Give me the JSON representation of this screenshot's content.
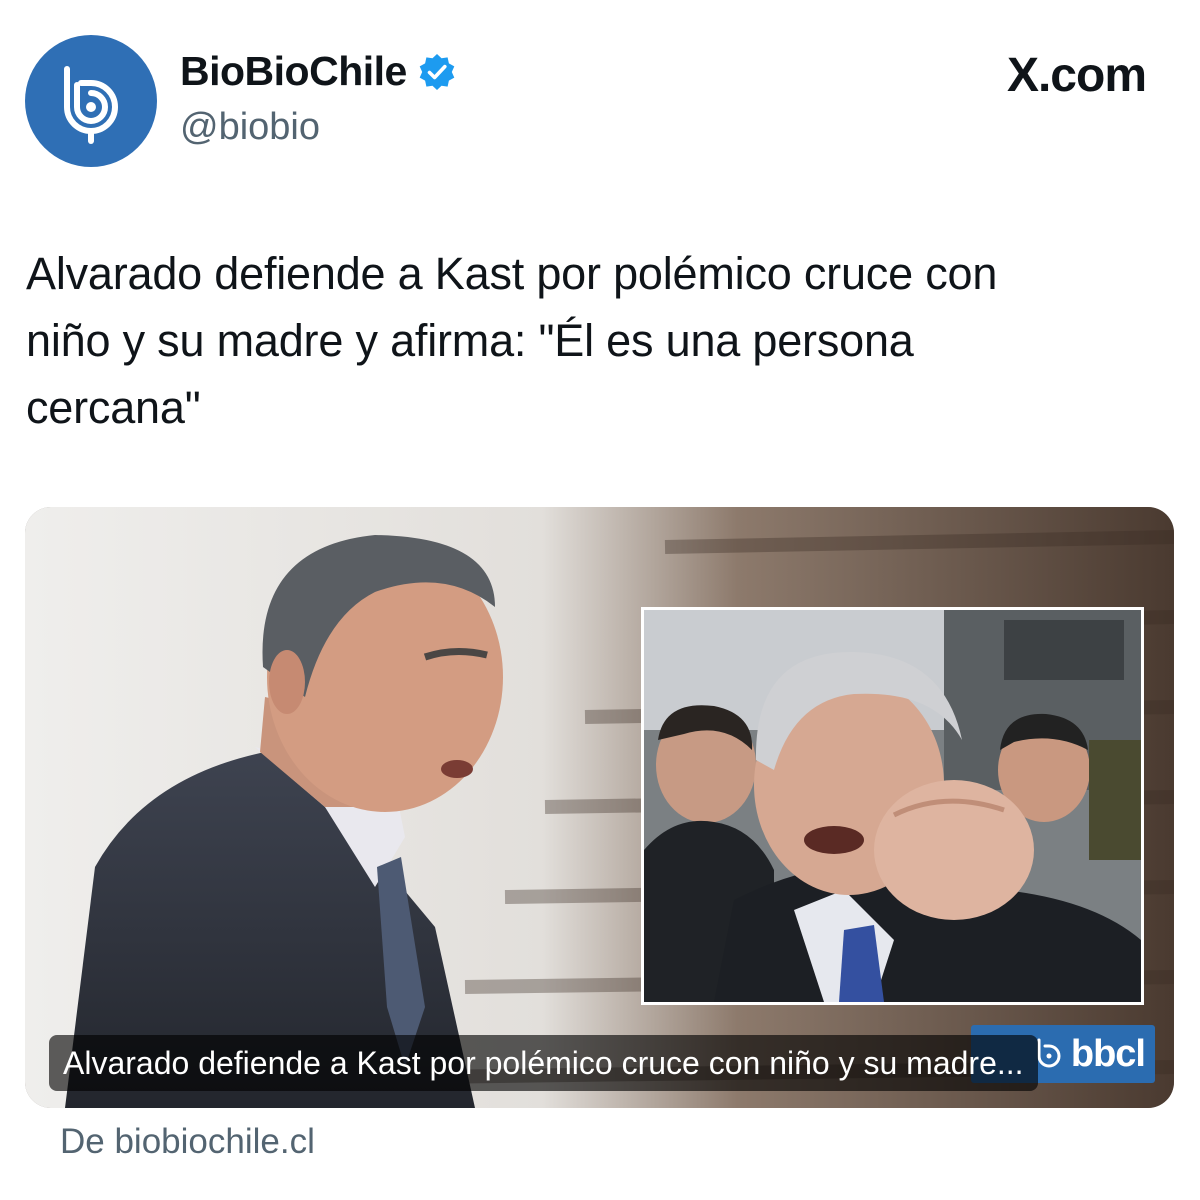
{
  "header": {
    "display_name": "BioBioChile",
    "handle": "@biobio",
    "brand": "X.com",
    "colors": {
      "avatar_bg": "#2f6fb5",
      "verified": "#1d9bf0",
      "handle": "#536471"
    }
  },
  "tweet": {
    "text_lines": [
      "Alvarado defiende a Kast por polémico cruce con",
      "niño y su madre y afirma: \"Él es una persona",
      "cercana\""
    ]
  },
  "card": {
    "caption": "Alvarado defiende a Kast por polémico cruce con niño y su madre...",
    "logo_text": "bbcl",
    "source": "De biobiochile.cl",
    "colors": {
      "logo_bg": "#2b6cb0"
    }
  }
}
